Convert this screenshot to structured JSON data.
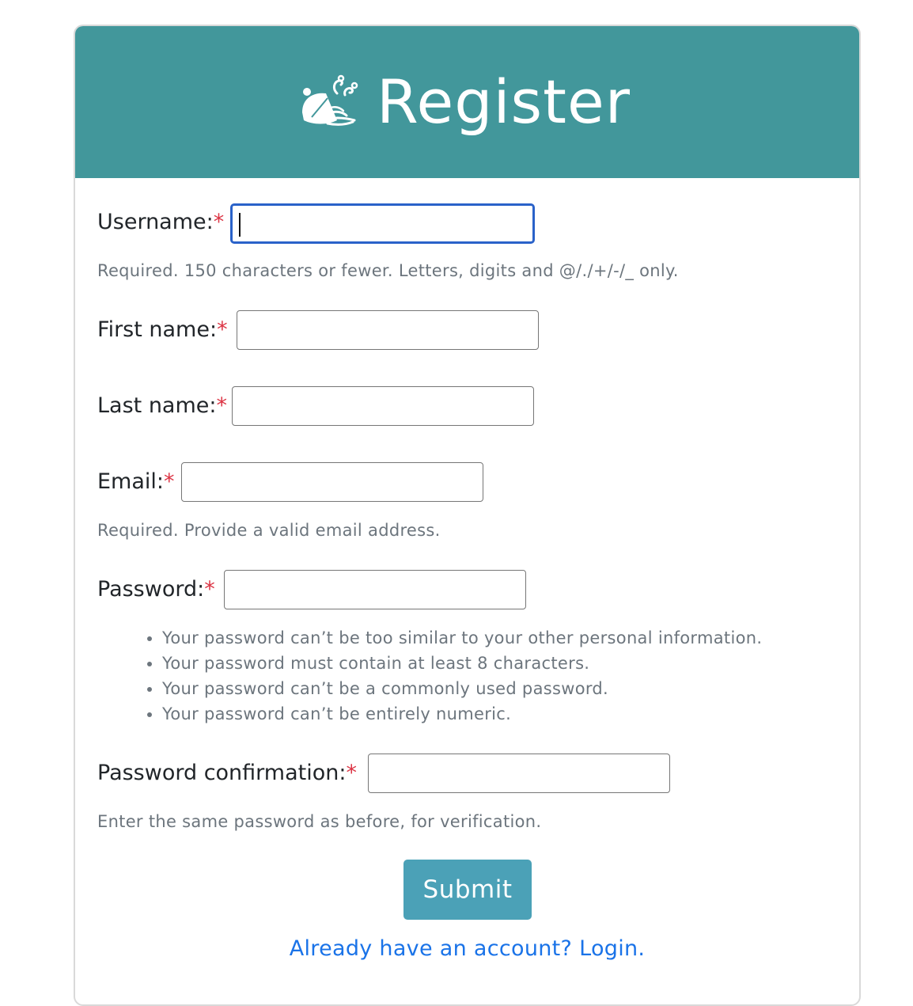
{
  "header": {
    "title": "Register",
    "icon": "dish-cloche-icon",
    "background_color": "#42979b"
  },
  "form": {
    "required_marker": "*",
    "fields": {
      "username": {
        "label": "Username:",
        "value": "",
        "help": "Required. 150 characters or fewer. Letters, digits and @/./+/-/_ only."
      },
      "first_name": {
        "label": "First name:",
        "value": ""
      },
      "last_name": {
        "label": "Last name:",
        "value": ""
      },
      "email": {
        "label": "Email:",
        "value": "",
        "help": "Required. Provide a valid email address."
      },
      "password": {
        "label": "Password:",
        "value": "",
        "rules": [
          "Your password can’t be too similar to your other personal information.",
          "Your password must contain at least 8 characters.",
          "Your password can’t be a commonly used password.",
          "Your password can’t be entirely numeric."
        ]
      },
      "password_confirmation": {
        "label": "Password confirmation:",
        "value": "",
        "help": "Enter the same password as before, for verification."
      }
    },
    "submit_label": "Submit",
    "submit_color": "#4ba1b7"
  },
  "footer": {
    "login_link": "Already have an account? Login.",
    "link_color": "#1a73e8"
  }
}
